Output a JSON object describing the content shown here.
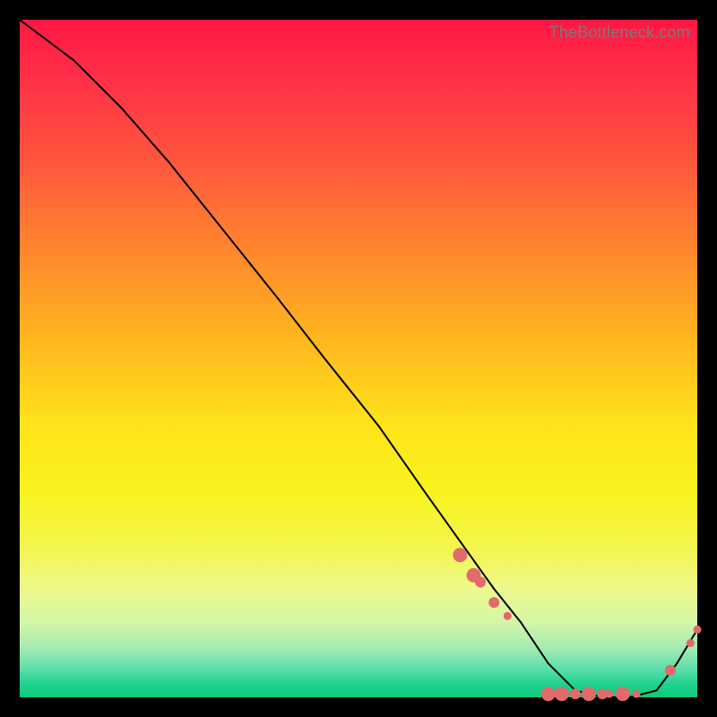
{
  "attribution": "TheBottleneck.com",
  "chart_data": {
    "type": "line",
    "title": "",
    "xlabel": "",
    "ylabel": "",
    "xlim": [
      0,
      100
    ],
    "ylim": [
      0,
      100
    ],
    "grid": false,
    "legend": false,
    "series": [
      {
        "name": "bottleneck-curve",
        "color": "#000000",
        "x": [
          0,
          8,
          15,
          22,
          30,
          38,
          45,
          53,
          60,
          65,
          70,
          74,
          78,
          82,
          86,
          90,
          94,
          97,
          100
        ],
        "y": [
          100,
          94,
          87,
          79,
          69,
          59,
          50,
          40,
          30,
          23,
          16,
          11,
          5,
          1,
          0,
          0,
          1,
          5,
          10
        ]
      }
    ],
    "markers": [
      {
        "name": "dot-a1",
        "x": 65,
        "y": 21,
        "size": "big"
      },
      {
        "name": "dot-a2",
        "x": 67,
        "y": 18,
        "size": "big"
      },
      {
        "name": "dot-a3",
        "x": 68,
        "y": 17,
        "size": "mid"
      },
      {
        "name": "dot-a4",
        "x": 70,
        "y": 14,
        "size": "mid"
      },
      {
        "name": "dot-a5",
        "x": 72,
        "y": 12,
        "size": "sm"
      },
      {
        "name": "dot-b1",
        "x": 78,
        "y": 0.5,
        "size": "big"
      },
      {
        "name": "dot-b2",
        "x": 80,
        "y": 0.5,
        "size": "big"
      },
      {
        "name": "dot-b3",
        "x": 82,
        "y": 0.5,
        "size": "mid"
      },
      {
        "name": "dot-b4",
        "x": 84,
        "y": 0.5,
        "size": "big"
      },
      {
        "name": "dot-b5",
        "x": 86,
        "y": 0.5,
        "size": "mid"
      },
      {
        "name": "dot-b6",
        "x": 87,
        "y": 0.5,
        "size": "sm"
      },
      {
        "name": "dot-b7",
        "x": 89,
        "y": 0.5,
        "size": "big"
      },
      {
        "name": "dot-b8",
        "x": 91,
        "y": 0.5,
        "size": "sm"
      },
      {
        "name": "dot-c1",
        "x": 96,
        "y": 4,
        "size": "mid"
      },
      {
        "name": "dot-c2",
        "x": 99,
        "y": 8,
        "size": "sm"
      },
      {
        "name": "dot-c3",
        "x": 100,
        "y": 10,
        "size": "sm"
      }
    ],
    "background_gradient": {
      "top": "#ff1744",
      "mid": "#ffe41a",
      "bottom": "#0acb7a"
    }
  }
}
